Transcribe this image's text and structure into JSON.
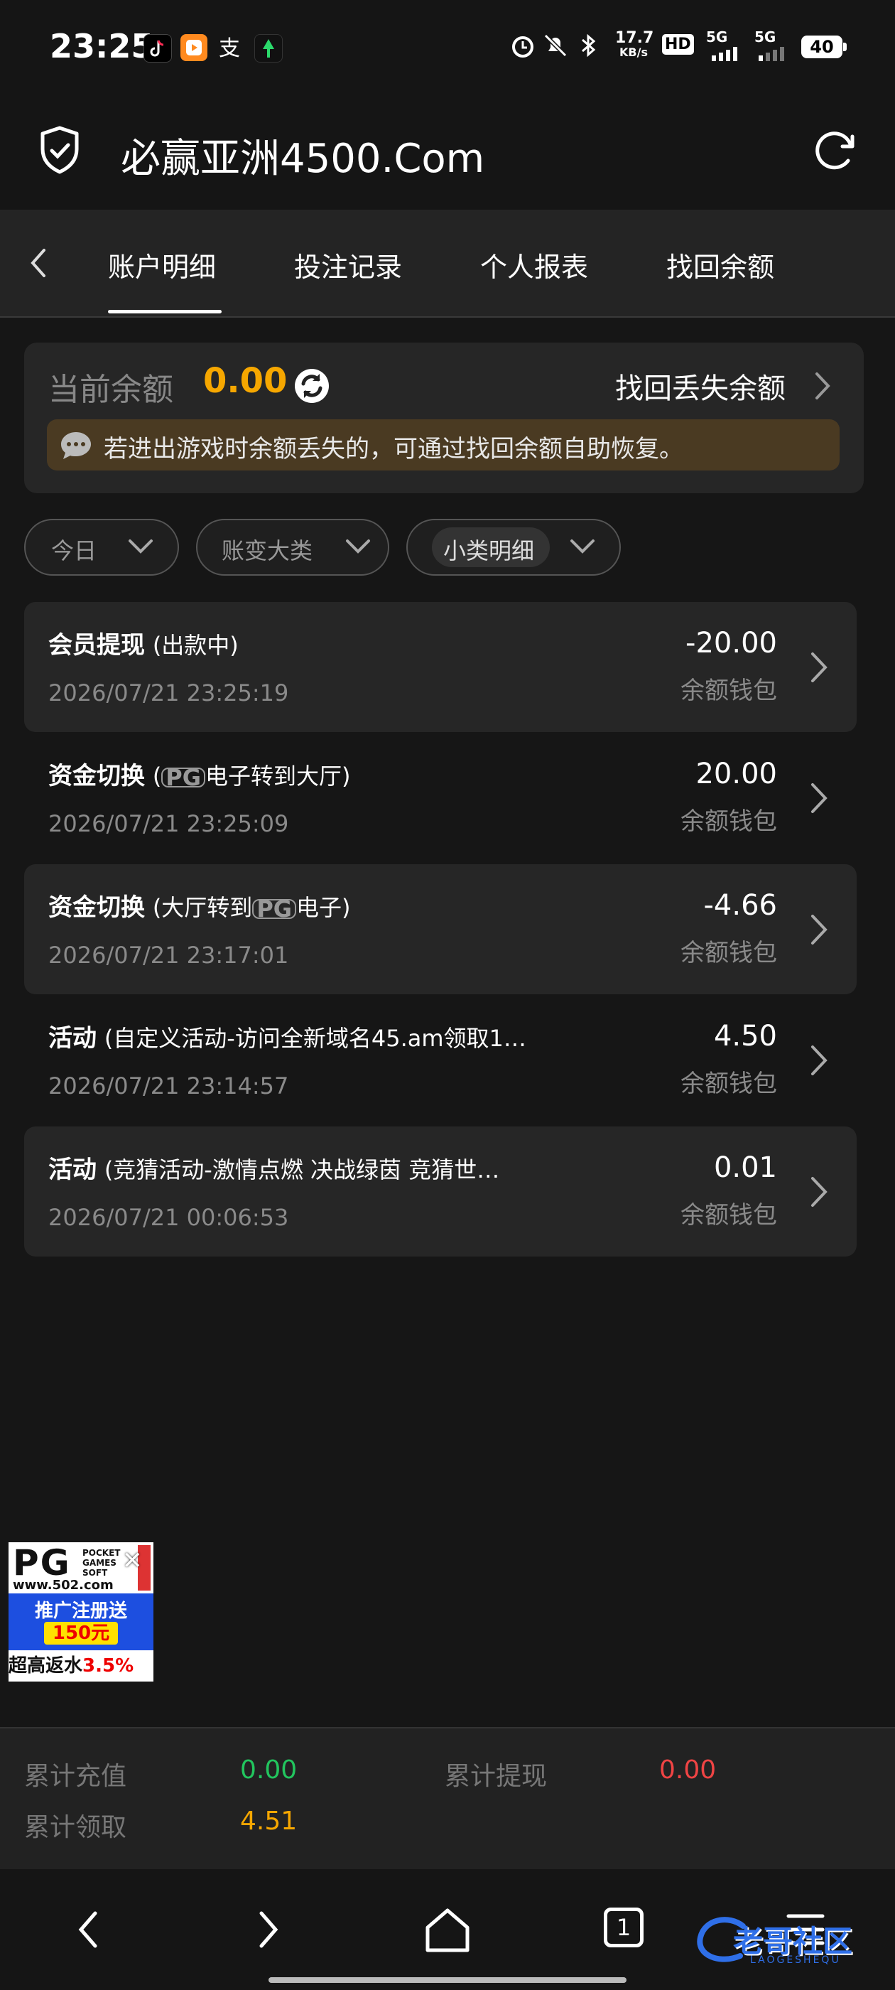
{
  "status_bar": {
    "time": "23:25",
    "app_icons": [
      "tiktok-icon",
      "media-app-icon",
      "alipay-icon",
      "green-app-icon"
    ],
    "speed": "17.7",
    "speed_unit": "KB/s",
    "hd_label": "HD",
    "sim1": "5G",
    "sim2": "5G",
    "battery": "40"
  },
  "header": {
    "title": "必赢亚洲4500.Com"
  },
  "tabs": [
    {
      "label": "账户明细",
      "active": true
    },
    {
      "label": "投注记录",
      "active": false
    },
    {
      "label": "个人报表",
      "active": false
    },
    {
      "label": "找回余额",
      "active": false
    }
  ],
  "balance": {
    "label": "当前余额",
    "value": "0.00",
    "recover_label": "找回丢失余额",
    "notice": "若进出游戏时余额丢失的，可通过找回余额自助恢复。"
  },
  "filters": [
    {
      "label": "今日"
    },
    {
      "label": "账变大类"
    },
    {
      "label": "小类明细"
    }
  ],
  "transactions": [
    {
      "type": "会员提现",
      "detail_pre": "(出款中)",
      "pg": "",
      "detail_post": "",
      "date": "2026/07/21 23:25:19",
      "amount": "-20.00",
      "wallet": "余额钱包"
    },
    {
      "type": "资金切换",
      "detail_pre": "(",
      "pg": "PG",
      "detail_post": "电子转到大厅)",
      "date": "2026/07/21 23:25:09",
      "amount": "20.00",
      "wallet": "余额钱包"
    },
    {
      "type": "资金切换",
      "detail_pre": "(大厅转到",
      "pg": "PG",
      "detail_post": "电子)",
      "date": "2026/07/21 23:17:01",
      "amount": "-4.66",
      "wallet": "余额钱包"
    },
    {
      "type": "活动",
      "detail_pre": "(自定义活动-访问全新域名45.am领取1…",
      "pg": "",
      "detail_post": "",
      "date": "2026/07/21 23:14:57",
      "amount": "4.50",
      "wallet": "余额钱包"
    },
    {
      "type": "活动",
      "detail_pre": "(竞猜活动-激情点燃 决战绿茵 竞猜世…",
      "pg": "",
      "detail_post": "",
      "date": "2026/07/21 00:06:53",
      "amount": "0.01",
      "wallet": "余额钱包"
    }
  ],
  "ad": {
    "logo": "PG",
    "logo_sub": "POCKET GAMES SOFT",
    "site": "www.502.com",
    "line1": "推广注册送",
    "line2": "150元",
    "line3_pre": "超高返水",
    "line3_pct": "3.5%"
  },
  "summary": {
    "recharge_label": "累计充值",
    "recharge_value": "0.00",
    "withdraw_label": "累计提现",
    "withdraw_value": "0.00",
    "claim_label": "累计领取",
    "claim_value": "4.51"
  },
  "nav": {
    "tab_count": "1",
    "watermark": "老哥社区",
    "watermark_sub": "LAOGESHEQU"
  },
  "colors": {
    "accent_orange": "#f6a700",
    "green": "#22c55e",
    "red": "#ef4444"
  }
}
